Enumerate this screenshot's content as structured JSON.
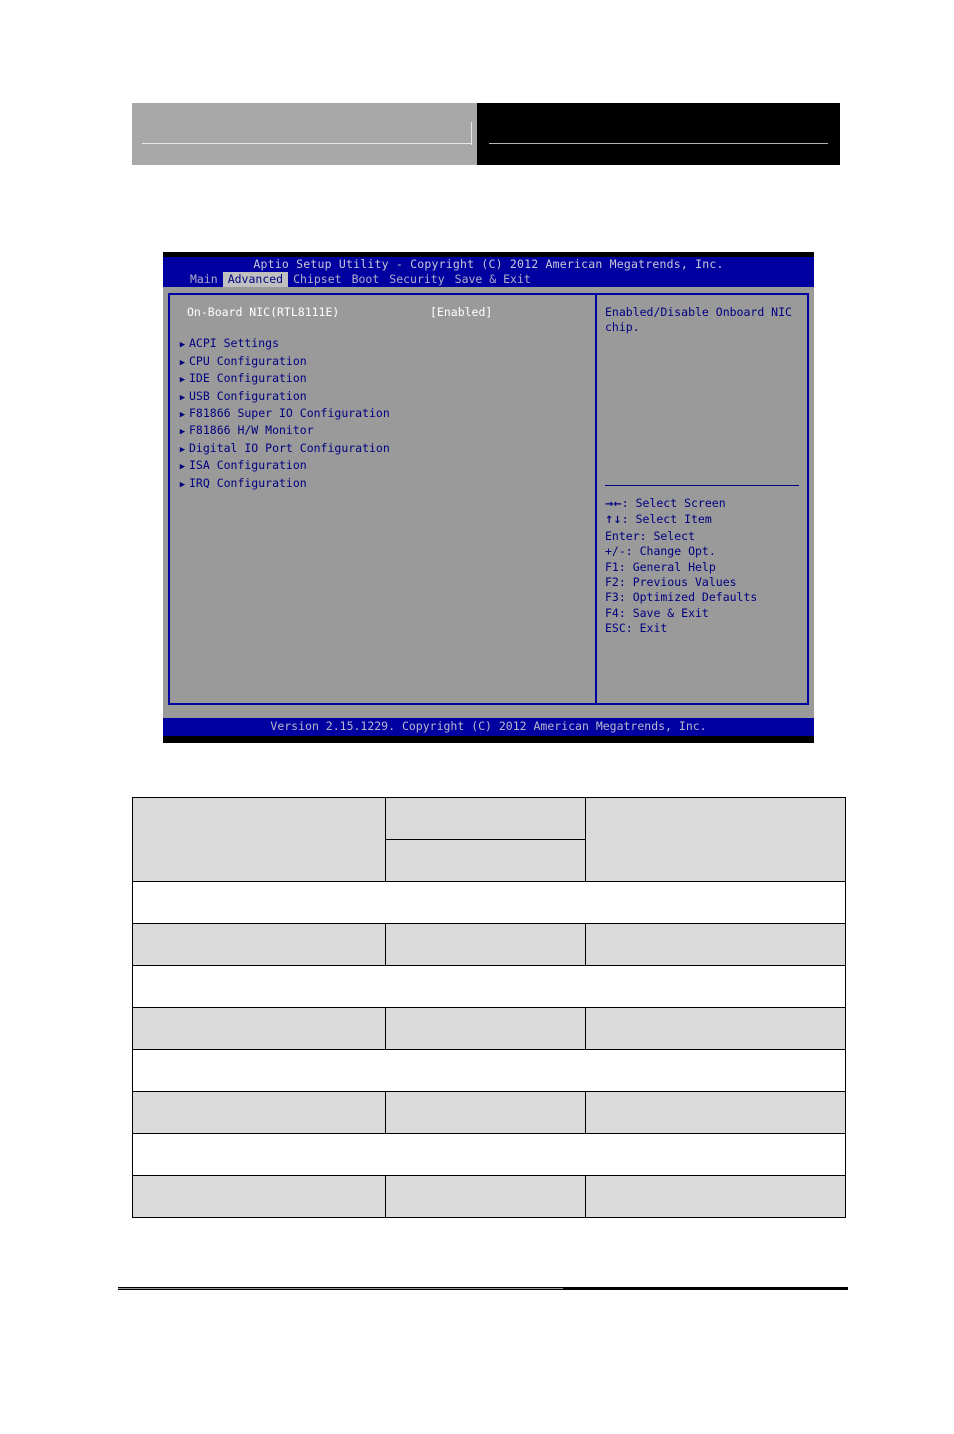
{
  "page_header": {
    "left_block": "",
    "right_block": ""
  },
  "bios": {
    "title": "Aptio Setup Utility - Copyright (C) 2012 American Megatrends, Inc.",
    "tabs": [
      {
        "label": "Main",
        "active": false
      },
      {
        "label": "Advanced",
        "active": true
      },
      {
        "label": "Chipset",
        "active": false
      },
      {
        "label": "Boot",
        "active": false
      },
      {
        "label": "Security",
        "active": false
      },
      {
        "label": "Save & Exit",
        "active": false
      }
    ],
    "setting": {
      "label": "On-Board NIC(RTL8111E)",
      "value": "[Enabled]"
    },
    "submenus": [
      {
        "arrow": "submenu-arrow-icon",
        "label": "ACPI Settings"
      },
      {
        "arrow": "submenu-arrow-icon",
        "label": "CPU Configuration"
      },
      {
        "arrow": "submenu-arrow-icon",
        "label": "IDE Configuration"
      },
      {
        "arrow": "submenu-arrow-icon",
        "label": "USB Configuration"
      },
      {
        "arrow": "submenu-arrow-icon",
        "label": "F81866 Super IO Configuration"
      },
      {
        "arrow": "submenu-arrow-icon",
        "label": "F81866 H/W Monitor"
      },
      {
        "arrow": "submenu-arrow-icon",
        "label": "Digital IO Port Configuration"
      },
      {
        "arrow": "submenu-arrow-icon",
        "label": "ISA Configuration"
      },
      {
        "arrow": "submenu-arrow-icon",
        "label": "IRQ Configuration"
      }
    ],
    "help": {
      "text": "Enabled/Disable Onboard NIC chip."
    },
    "keys": [
      {
        "glyph": "→←",
        "text": ": Select Screen"
      },
      {
        "glyph": "↑↓",
        "text": ": Select Item"
      },
      {
        "glyph": "",
        "text": "Enter: Select"
      },
      {
        "glyph": "",
        "text": "+/-: Change Opt."
      },
      {
        "glyph": "",
        "text": "F1: General Help"
      },
      {
        "glyph": "",
        "text": "F2: Previous Values"
      },
      {
        "glyph": "",
        "text": "F3: Optimized Defaults"
      },
      {
        "glyph": "",
        "text": "F4: Save & Exit"
      },
      {
        "glyph": "",
        "text": "ESC: Exit"
      }
    ],
    "footer": "Version 2.15.1229. Copyright (C) 2012 American Megatrends, Inc.",
    "colors": {
      "window_blue": "#0000a0",
      "panel_gray": "#9a9a9a",
      "active_tab_bg": "#c0c0c0",
      "text_white": "#ffffff",
      "text_navy": "#000080"
    }
  },
  "spec_table": {
    "rows": [
      {
        "type": "split",
        "cells": [
          "",
          "",
          "",
          ""
        ]
      },
      {
        "type": "full",
        "cells": [
          ""
        ]
      },
      {
        "type": "three",
        "cells": [
          "",
          "",
          ""
        ]
      },
      {
        "type": "full",
        "cells": [
          ""
        ]
      },
      {
        "type": "three",
        "cells": [
          "",
          "",
          ""
        ]
      },
      {
        "type": "full",
        "cells": [
          ""
        ]
      },
      {
        "type": "three",
        "cells": [
          "",
          "",
          ""
        ]
      },
      {
        "type": "full",
        "cells": [
          ""
        ]
      },
      {
        "type": "three",
        "cells": [
          "",
          "",
          ""
        ]
      }
    ]
  }
}
